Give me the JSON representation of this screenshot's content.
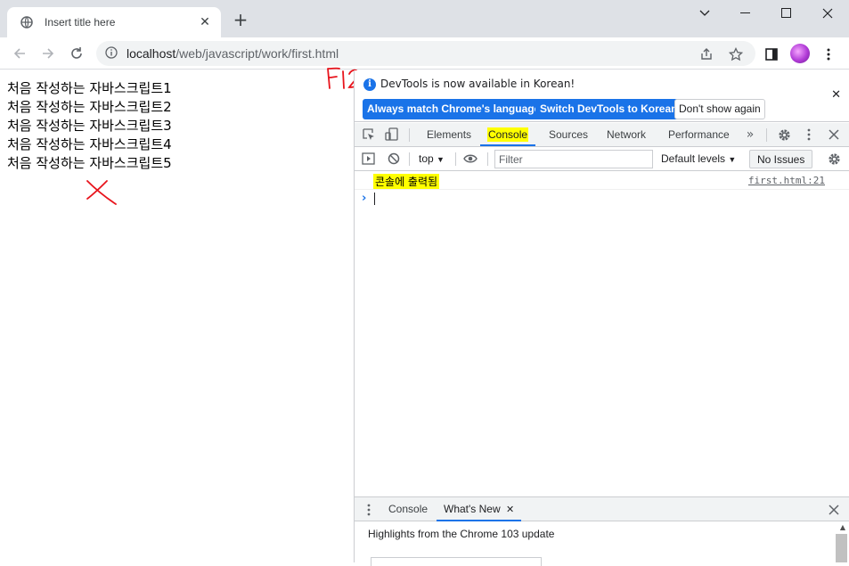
{
  "browser": {
    "tab_title": "Insert title here",
    "url_host": "localhost",
    "url_path": "/web/javascript/work/first.html"
  },
  "page": {
    "lines": [
      "처음 작성하는 자바스크립트1",
      "처음 작성하는 자바스크립트2",
      "처음 작성하는 자바스크립트3",
      "처음 작성하는 자바스크립트4",
      "처음 작성하는 자바스크립트5"
    ],
    "annotation_f12": "F12"
  },
  "devtools": {
    "infobar": {
      "message": "DevTools is now available in Korean!",
      "btn_match": "Always match Chrome's language",
      "btn_switch": "Switch DevTools to Korean",
      "btn_dont_show": "Don't show again"
    },
    "tabs": [
      "Elements",
      "Console",
      "Sources",
      "Network",
      "Performance"
    ],
    "active_tab": "Console",
    "console_toolbar": {
      "context": "top",
      "filter_placeholder": "Filter",
      "levels": "Default levels",
      "issues": "No Issues"
    },
    "messages": [
      {
        "text": "콘솔에 출력됨",
        "source": "first.html:21"
      }
    ],
    "drawer": {
      "tabs": [
        "Console",
        "What's New"
      ],
      "active_tab": "What's New",
      "whats_new_text": "Highlights from the Chrome 103 update"
    }
  },
  "colors": {
    "accent": "#1a73e8",
    "highlight": "#ffff00",
    "annotation": "#e8141c"
  }
}
